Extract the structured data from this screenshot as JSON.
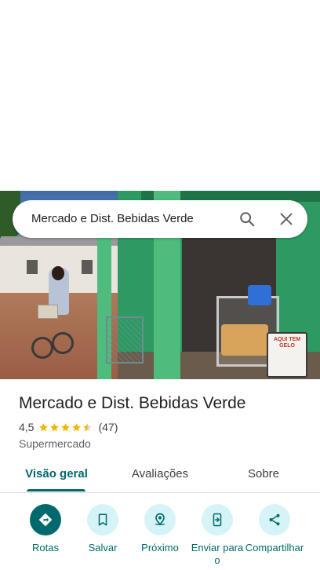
{
  "search": {
    "query": "Mercado e Dist. Bebidas Verde"
  },
  "place": {
    "name": "Mercado e Dist. Bebidas Verde",
    "rating": "4,5",
    "rating_stars": 4.5,
    "review_count": "(47)",
    "category": "Supermercado",
    "photo_sign_text": "AQUI TEM GELO"
  },
  "tabs": [
    {
      "label": "Visão geral",
      "active": true
    },
    {
      "label": "Avaliações",
      "active": false
    },
    {
      "label": "Sobre",
      "active": false
    }
  ],
  "actions": [
    {
      "label": "Rotas",
      "icon": "directions-icon"
    },
    {
      "label": "Salvar",
      "icon": "bookmark-icon"
    },
    {
      "label": "Próximo",
      "icon": "nearby-icon"
    },
    {
      "label": "Enviar para o",
      "icon": "send-to-phone-icon"
    },
    {
      "label": "Compartilhar",
      "icon": "share-icon"
    }
  ],
  "colors": {
    "accent": "#00696d",
    "action_bg": "#d6f3f7",
    "star": "#f4b400"
  }
}
